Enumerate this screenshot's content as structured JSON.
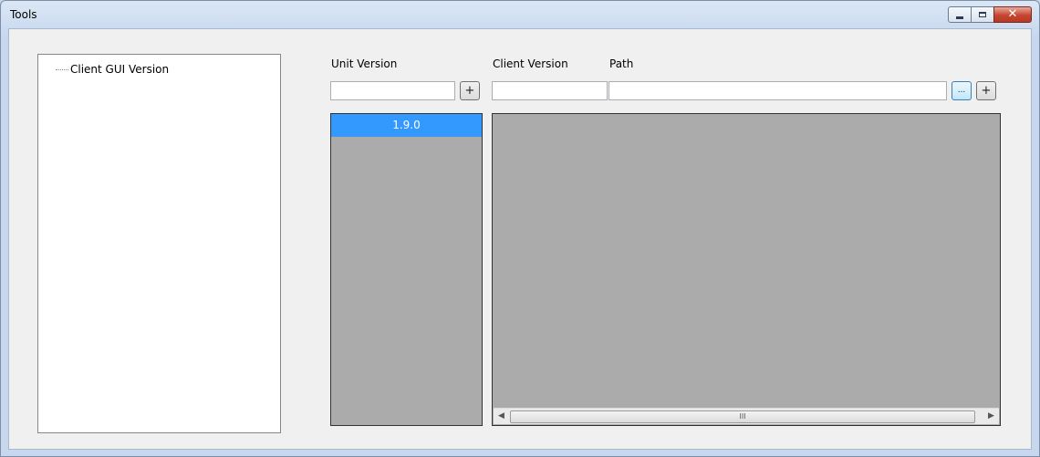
{
  "window": {
    "title": "Tools",
    "minimize_icon": "minimize-icon",
    "maximize_icon": "maximize-icon",
    "close_icon": "close-icon",
    "close_glyph": "✕"
  },
  "tree": {
    "nodes": [
      {
        "label": "Client GUI Version"
      }
    ]
  },
  "unit_version": {
    "label": "Unit Version",
    "value": "",
    "add_label": "+",
    "items": [
      {
        "label": "1.9.0",
        "selected": true
      }
    ]
  },
  "client_version": {
    "label": "Client Version",
    "value": ""
  },
  "path": {
    "label": "Path",
    "value": "",
    "browse_label": "...",
    "add_label": "+"
  },
  "grid": {
    "scroll_left": "◀",
    "scroll_right": "▶",
    "thumb_grip": "III"
  },
  "colors": {
    "selection": "#3399ff",
    "panel_background": "#ababab",
    "close_button": "#c6452f"
  }
}
